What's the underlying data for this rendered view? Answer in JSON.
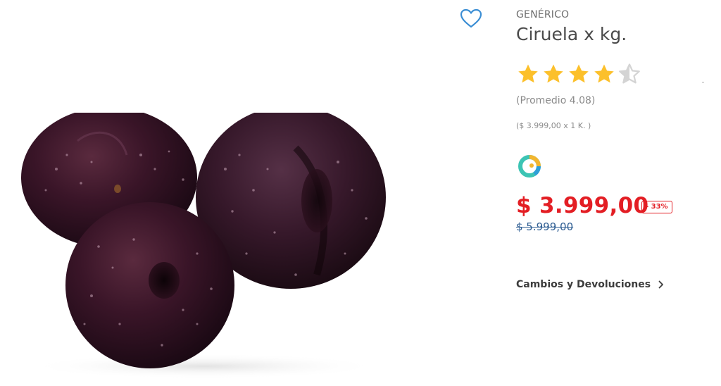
{
  "product": {
    "brand": "GENÉRICO",
    "name": "Ciruela x kg.",
    "rating": {
      "value": 4.08,
      "max": 5,
      "filled_color": "#fcc02b",
      "empty_color": "#d4d4d4",
      "average_text": "(Promedio 4.08)"
    },
    "unit_price_text": "($ 3.999,00 x 1 K. )",
    "seller_logo_icon": "seller-logo-icon",
    "price": "$ 3.999,00",
    "discount": "- 33%",
    "old_price": "$ 5.999,00",
    "image_icon": "plums-image"
  },
  "favorite": {
    "icon": "heart-icon",
    "color": "#3b8ed4"
  },
  "links": {
    "returns_label": "Cambios y Devoluciones",
    "returns_icon": "chevron-right-icon"
  },
  "colors": {
    "price": "#e31e24",
    "old_price": "#2f5e93",
    "text_primary": "#4a4a4a",
    "text_muted": "#8a8a8a"
  }
}
